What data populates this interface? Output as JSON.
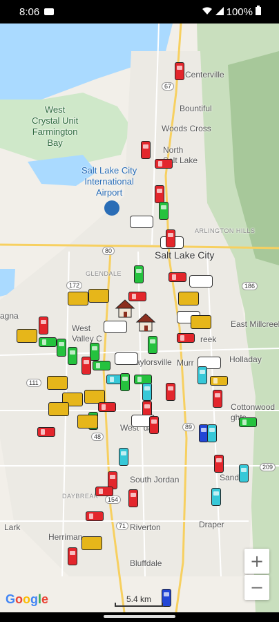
{
  "status_bar": {
    "time": "8:06",
    "battery": "100%"
  },
  "map": {
    "places": {
      "centerville": "Centerville",
      "bountiful": "Bountiful",
      "woods_cross": "Woods Cross",
      "north_salt_lake": "North\nSalt Lake",
      "west_crystal": "West\nCrystal Unit\nFarmington\nBay",
      "airport": "Salt Lake City\nInternational\nAirport",
      "arlington_hills": "ARLINGTON HILLS",
      "salt_lake_city": "Salt Lake City",
      "glendale": "GLENDALE",
      "magna": "agna",
      "west_valley": "West\nValley C",
      "south_salt_lake": "reek",
      "east_millcreek": "East Millcreek",
      "holladay": "Holladay",
      "taylorsville": "aylorsville",
      "murray": "Murr",
      "cottonwood_heights": "Cottonwood\nghts",
      "west_jordan": "West  dan",
      "south_jordan": "South Jordan",
      "daybreak": "DAYBREAK",
      "sandy": "Sand",
      "riverton": "Riverton",
      "draper": "Draper",
      "lark": "Lark",
      "herriman": "Herriman",
      "bluffdale": "Bluffdale"
    },
    "shields": {
      "i67": "67",
      "i80": "80",
      "i172": "172",
      "i186": "186",
      "i111": "111",
      "i48": "48",
      "i89": "89",
      "i209": "209",
      "i154": "154",
      "i71": "71"
    },
    "scale_label": "5.4 km",
    "google_logo": [
      "G",
      "o",
      "o",
      "g",
      "l",
      "e"
    ],
    "google_colors": [
      "#4285F4",
      "#EA4335",
      "#FBBC05",
      "#4285F4",
      "#34A853",
      "#EA4335"
    ],
    "zoom_in": "+",
    "zoom_out": "−",
    "vehicle_colors": {
      "red": "#e3262c",
      "green": "#25c23e",
      "cyan": "#37c8d8",
      "blue": "#2246d6",
      "yellow": "#e6b61a"
    }
  }
}
